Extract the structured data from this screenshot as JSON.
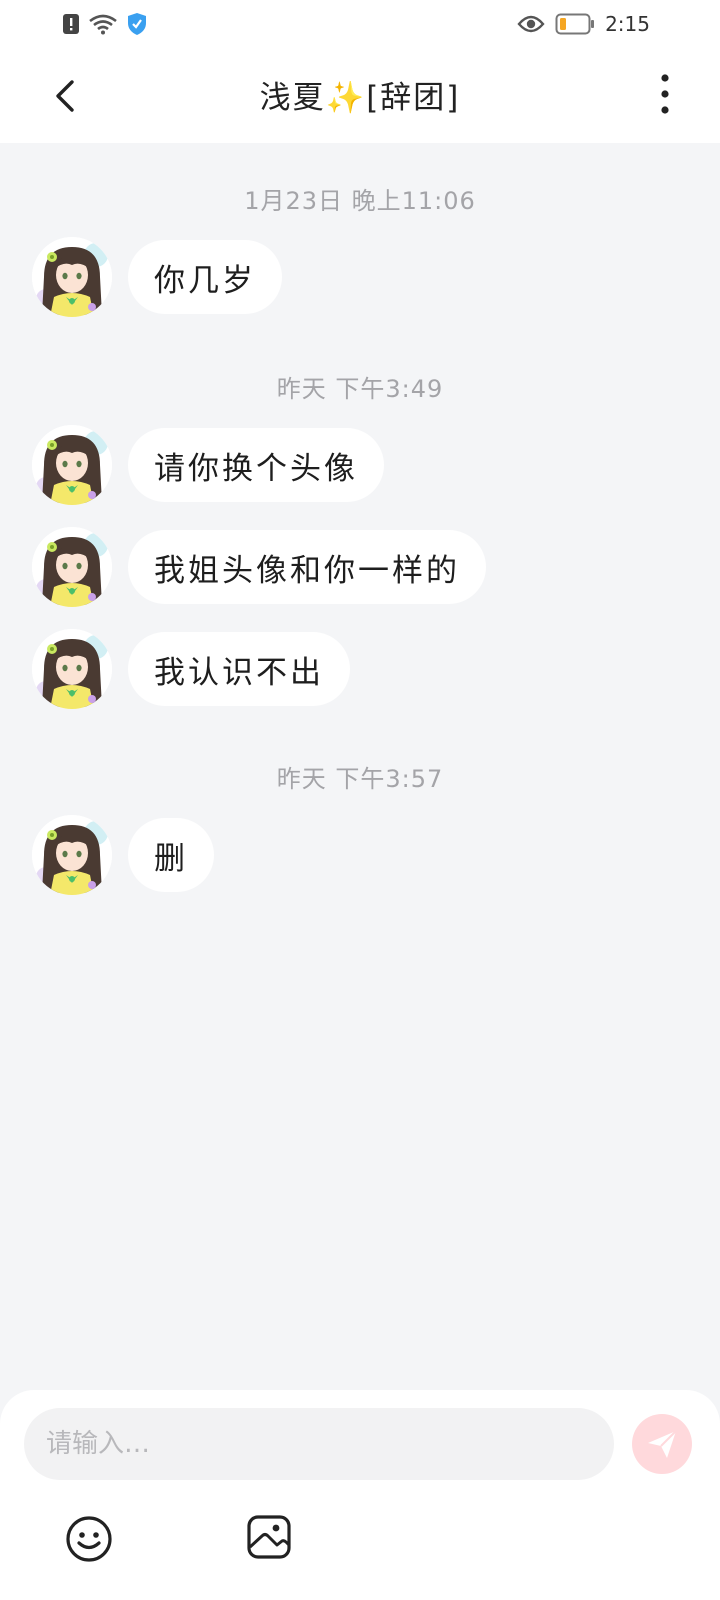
{
  "status_bar": {
    "time": "2:15",
    "left_icons": [
      "alert-icon",
      "wifi-icon",
      "shield-icon"
    ],
    "right_icons": [
      "eye-icon",
      "battery-icon"
    ]
  },
  "header": {
    "title": "浅夏✨[辞团]",
    "back_icon": "chevron-left-icon",
    "more_icon": "more-vertical-icon"
  },
  "messages": [
    {
      "type": "timestamp",
      "text": "1月23日 晚上11:06"
    },
    {
      "type": "incoming",
      "text": "你几岁"
    },
    {
      "type": "timestamp",
      "text": "昨天 下午3:49"
    },
    {
      "type": "incoming",
      "text": "请你换个头像"
    },
    {
      "type": "incoming",
      "text": "我姐头像和你一样的"
    },
    {
      "type": "incoming",
      "text": "我认识不出"
    },
    {
      "type": "timestamp",
      "text": "昨天 下午3:57"
    },
    {
      "type": "incoming",
      "text": "删"
    }
  ],
  "input": {
    "placeholder": "请输入…",
    "value": ""
  },
  "colors": {
    "background": "#f4f5f7",
    "bubble": "#ffffff",
    "send_button": "#ffd9dc",
    "timestamp_text": "#a4a4a8"
  }
}
